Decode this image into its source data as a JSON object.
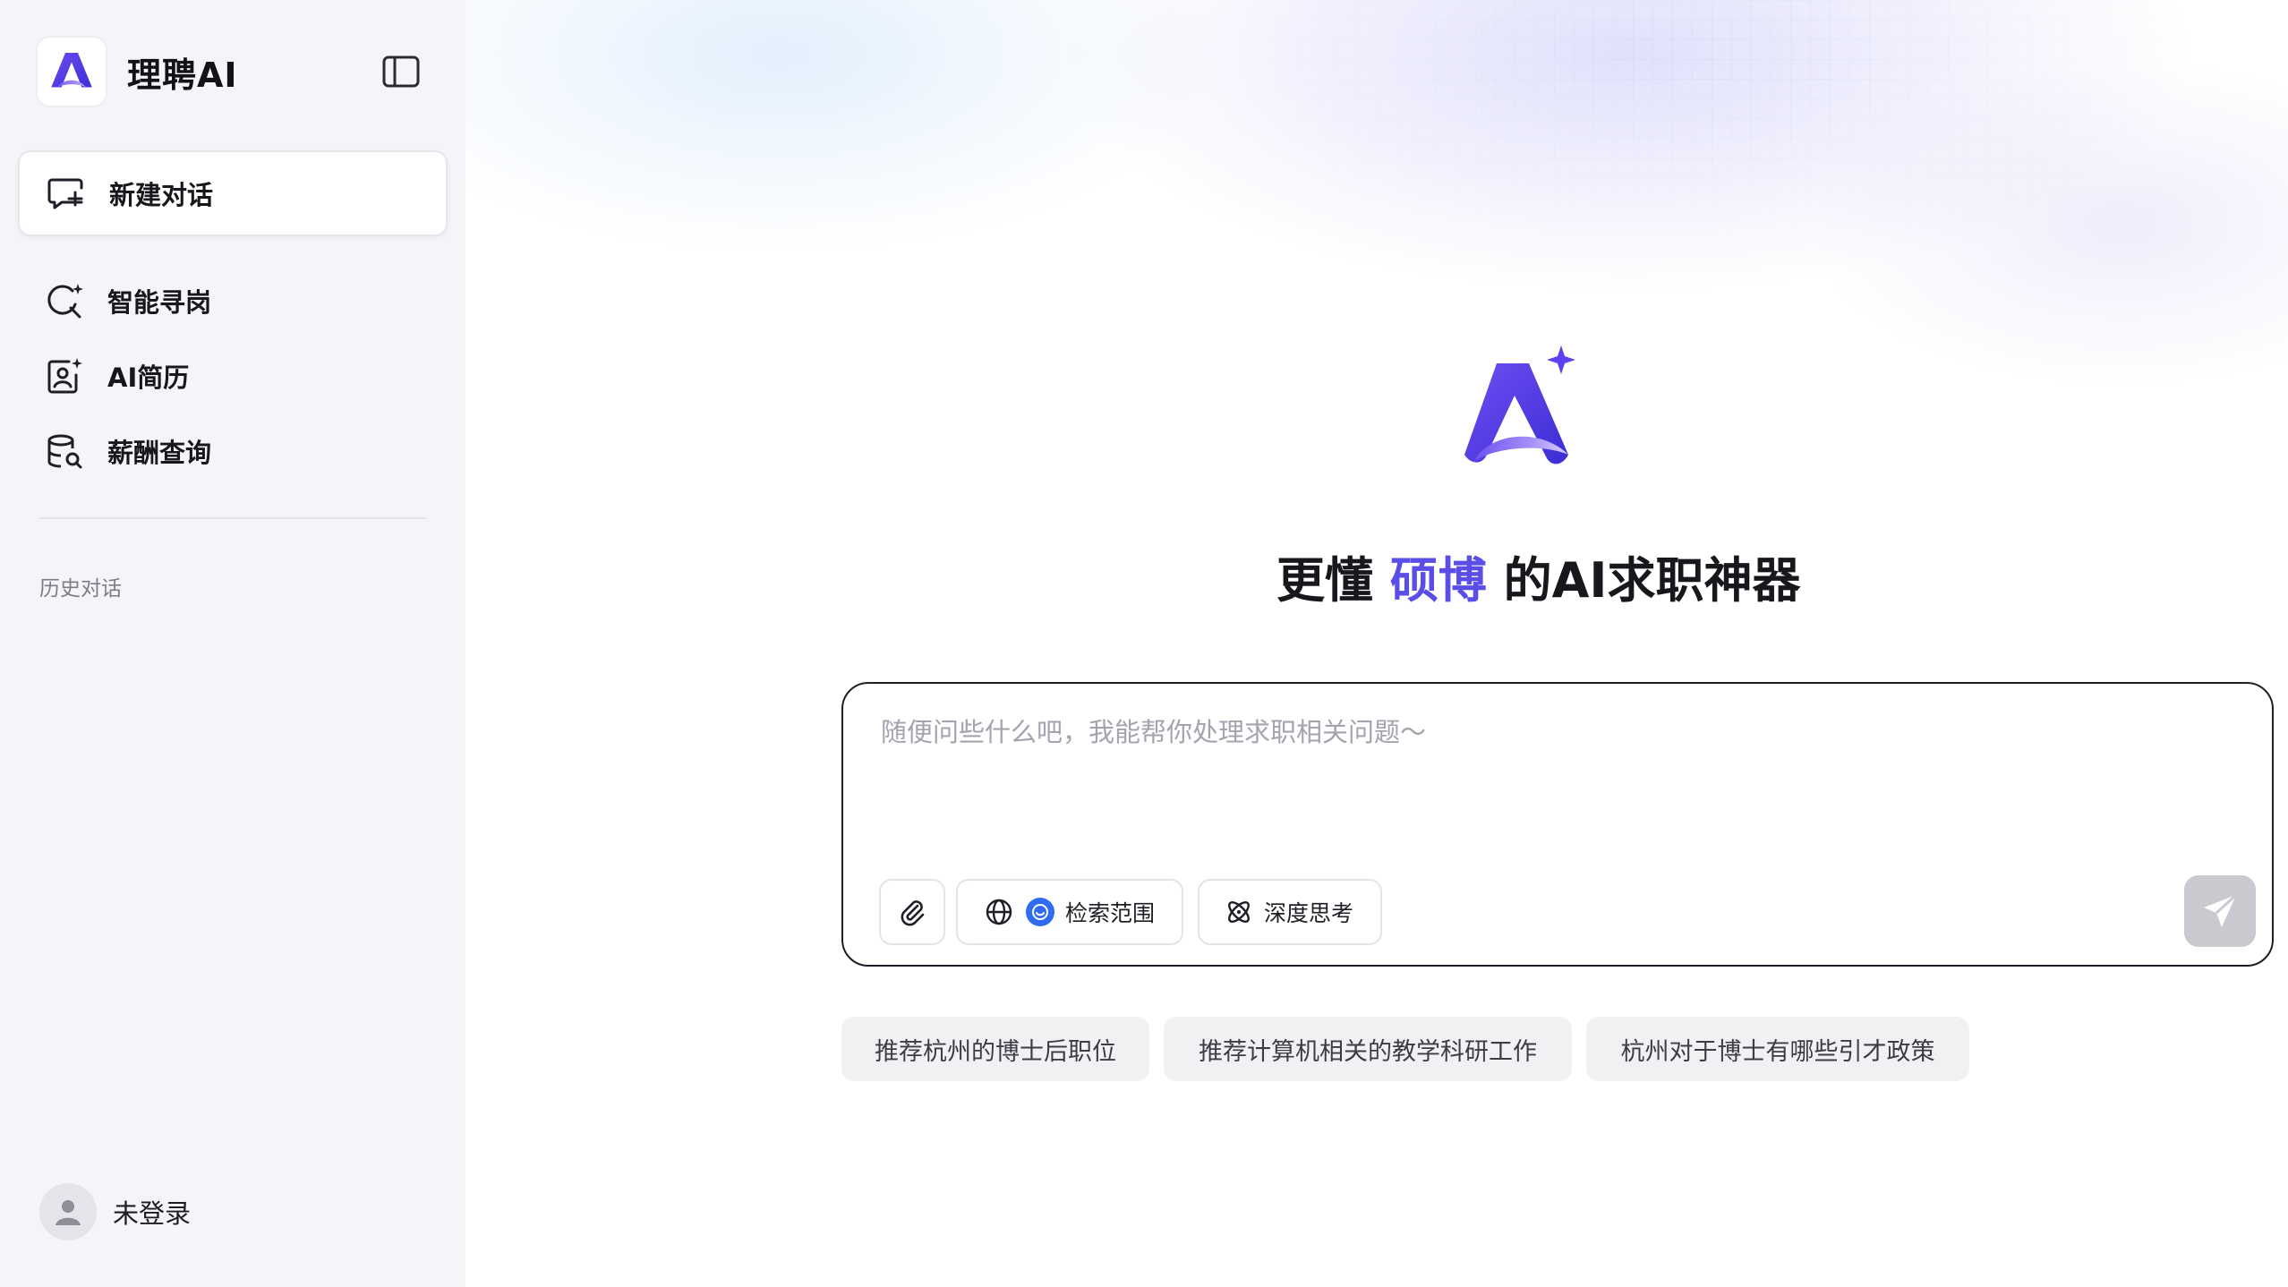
{
  "brand": {
    "name": "理聘AI"
  },
  "sidebar": {
    "new_chat_label": "新建对话",
    "items": [
      {
        "label": "智能寻岗",
        "icon": "search-sparkle-icon"
      },
      {
        "label": "AI简历",
        "icon": "resume-icon"
      },
      {
        "label": "薪酬查询",
        "icon": "salary-database-icon"
      }
    ],
    "history_title": "历史对话",
    "user_label": "未登录"
  },
  "hero": {
    "title_prefix": "更懂",
    "title_accent": "硕博",
    "title_suffix": "的AI求职神器"
  },
  "composer": {
    "placeholder": "随便问些什么吧，我能帮你处理求职相关问题～",
    "search_scope_label": "检索范围",
    "deep_think_label": "深度思考"
  },
  "suggestions": [
    "推荐杭州的博士后职位",
    "推荐计算机相关的教学科研工作",
    "杭州对于博士有哪些引才政策"
  ],
  "colors": {
    "accent": "#5b4de8",
    "sidebar_bg": "#f4f4f9",
    "send_disabled": "#c9c9cf",
    "chip_bg": "#f1f1f4"
  }
}
